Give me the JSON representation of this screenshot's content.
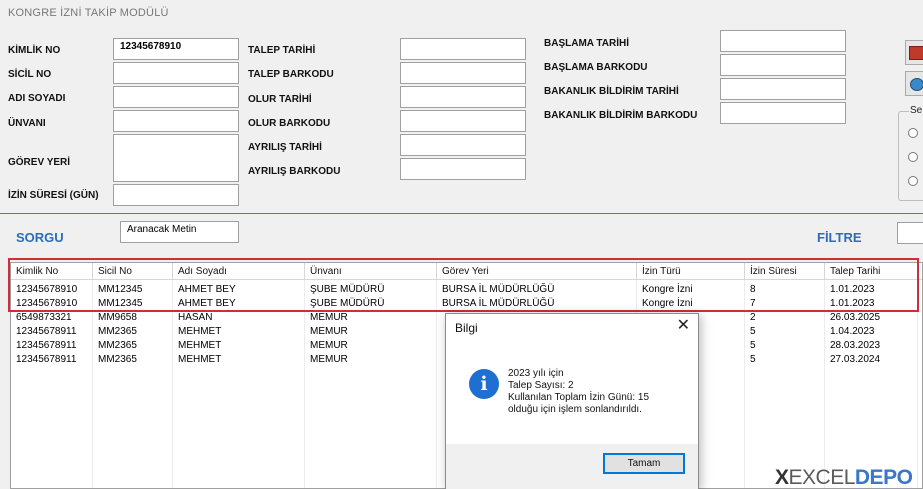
{
  "window": {
    "title": "KONGRE İZNİ TAKİP MODÜLÜ"
  },
  "form": {
    "left": [
      {
        "label": "KİMLİK NO",
        "value": "12345678910"
      },
      {
        "label": "SİCİL NO",
        "value": ""
      },
      {
        "label": "ADI SOYADI",
        "value": ""
      },
      {
        "label": "ÜNVANI",
        "value": ""
      },
      {
        "label": "GÖREV YERİ",
        "value": ""
      },
      {
        "label": "İZİN SÜRESİ (GÜN)",
        "value": ""
      }
    ],
    "middle": [
      {
        "label": "TALEP TARİHİ",
        "value": ""
      },
      {
        "label": "TALEP BARKODU",
        "value": ""
      },
      {
        "label": "OLUR TARİHİ",
        "value": ""
      },
      {
        "label": "OLUR BARKODU",
        "value": ""
      },
      {
        "label": "AYRILIŞ TARİHİ",
        "value": ""
      },
      {
        "label": "AYRILIŞ BARKODU",
        "value": ""
      }
    ],
    "right": [
      {
        "label": "BAŞLAMA TARİHİ",
        "value": ""
      },
      {
        "label": "BAŞLAMA BARKODU",
        "value": ""
      },
      {
        "label": "BAKANLIK BİLDİRİM TARİHİ",
        "value": ""
      },
      {
        "label": "BAKANLIK BİLDİRİM BARKODU",
        "value": ""
      }
    ]
  },
  "side": {
    "group_title": "Se"
  },
  "search": {
    "label": "SORGU",
    "value": "Aranacak Metin",
    "filter_label": "FİLTRE"
  },
  "table": {
    "columns": [
      "Kimlik No",
      "Sicil No",
      "Adı Soyadı",
      "Ünvanı",
      "Görev Yeri",
      "İzin Türü",
      "İzin Süresi",
      "Talep Tarihi"
    ],
    "rows": [
      [
        "12345678910",
        "MM12345",
        "AHMET BEY",
        "ŞUBE MÜDÜRÜ",
        "BURSA İL MÜDÜRLÜĞÜ",
        "Kongre İzni",
        "8",
        "1.01.2023"
      ],
      [
        "12345678910",
        "MM12345",
        "AHMET BEY",
        "ŞUBE MÜDÜRÜ",
        "BURSA İL MÜDÜRLÜĞÜ",
        "Kongre İzni",
        "7",
        "1.01.2023"
      ],
      [
        "6549873321",
        "MM9658",
        "HASAN",
        "MEMUR",
        "",
        "",
        "2",
        "26.03.2025"
      ],
      [
        "12345678911",
        "MM2365",
        "MEHMET",
        "MEMUR",
        "",
        "",
        "5",
        "1.04.2023"
      ],
      [
        "12345678911",
        "MM2365",
        "MEHMET",
        "MEMUR",
        "",
        "",
        "5",
        "28.03.2023"
      ],
      [
        "12345678911",
        "MM2365",
        "MEHMET",
        "MEMUR",
        "",
        "",
        "5",
        "27.03.2024"
      ]
    ]
  },
  "dialog": {
    "title": "Bilgi",
    "close": "✕",
    "icon": "i",
    "lines": [
      "2023 yılı için",
      "Talep Sayısı: 2",
      "Kullanılan Toplam İzin Günü: 15",
      "olduğu için işlem sonlandırıldı."
    ],
    "ok_label": "Tamam"
  },
  "watermark": {
    "x": "X",
    "excel": "EXCEL",
    "depo": "DEPO"
  },
  "icons": {
    "dialog": "info-icon",
    "side1": "save-icon",
    "side2": "refresh-icon",
    "close": "close-icon"
  },
  "colors": {
    "accent": "#2a6ebb",
    "highlight": "#cf2e38",
    "info": "#1f6fd1"
  }
}
